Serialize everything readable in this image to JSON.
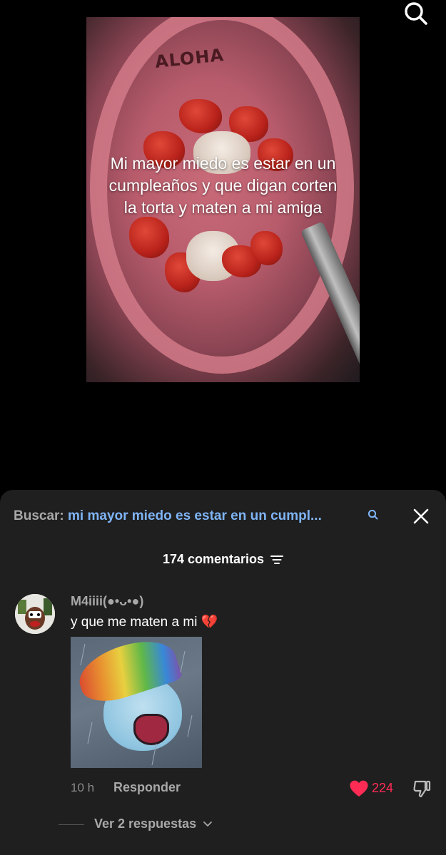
{
  "video": {
    "brand_text": "ALOHA",
    "caption": "Mi mayor miedo es estar en un cumpleaños y que digan corten la torta y maten a mi amiga"
  },
  "icons": {
    "top_search": "search-icon",
    "sheet_search": "search-icon",
    "close": "close-icon",
    "filter": "filter-icon",
    "like": "heart-icon",
    "dislike": "thumbs-down-icon",
    "expand": "chevron-down-icon"
  },
  "comments_sheet": {
    "search_label": "Buscar:",
    "search_query": "mi mayor miedo es estar en un cumpl...",
    "count_label": "174 comentarios",
    "comment": {
      "username": "M4iiii(●•ᴗ•●)",
      "text": "y que me maten a mi",
      "emoji": "💔",
      "time": "10 h",
      "reply_label": "Responder",
      "likes": "224",
      "view_replies_label": "Ver 2 respuestas"
    }
  },
  "colors": {
    "background": "#000000",
    "sheet": "#1f1f1f",
    "link_blue": "#7fb4f5",
    "like_red": "#fe2c55"
  }
}
